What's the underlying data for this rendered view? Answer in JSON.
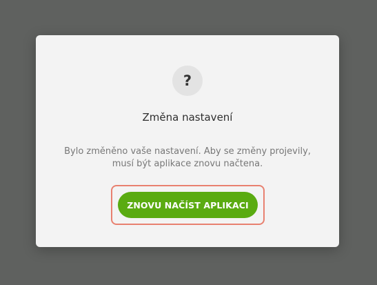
{
  "dialog": {
    "icon": "question-mark-icon",
    "icon_glyph": "?",
    "title": "Změna nastavení",
    "message_line1": "Bylo změněno vaše nastavení. Aby se změny projevily,",
    "message_line2": "musí být aplikace znovu načtena.",
    "reload_button_label": "ZNOVU NAČÍST APLIKACI"
  },
  "colors": {
    "backdrop": "#5f615f",
    "dialog_background": "#f3f3f3",
    "button_background": "#5aab11",
    "focus_ring": "#e8806f"
  }
}
